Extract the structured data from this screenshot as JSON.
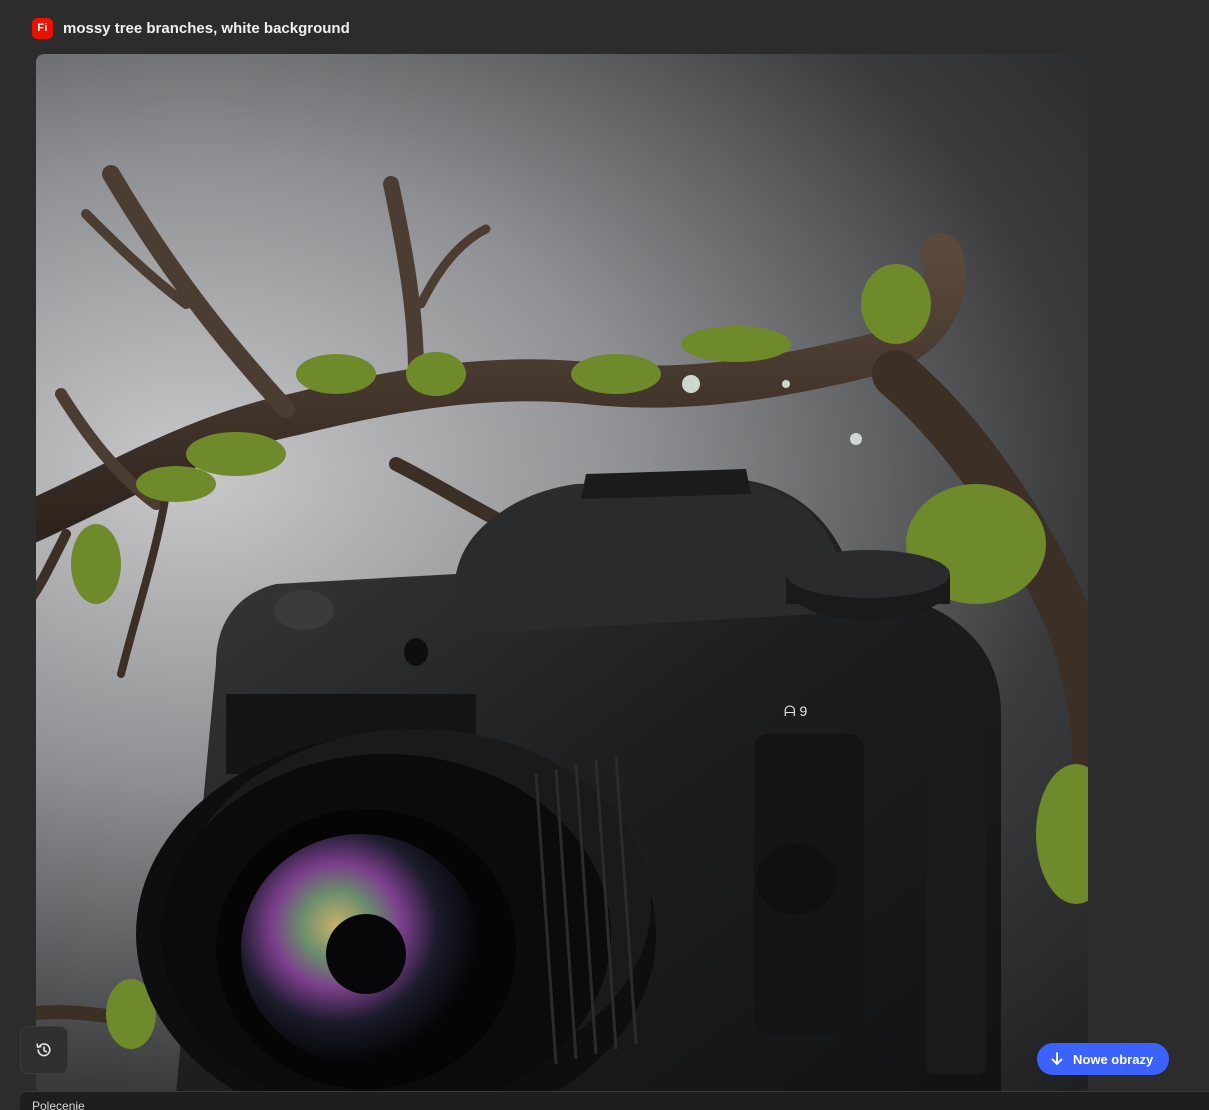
{
  "header": {
    "app_badge": "Fi",
    "prompt_title": "mossy tree branches, white background"
  },
  "image": {
    "description_icon": "generated-image"
  },
  "camera": {
    "mode_label": "ᗩ 9"
  },
  "actions": {
    "history_icon": "history-icon",
    "new_images_label": "Nowe obrazy",
    "new_images_icon": "arrow-down-icon"
  },
  "prompt_panel": {
    "label": "Polecenie"
  },
  "colors": {
    "background": "#2c2c2c",
    "accent_blue": "#3b63fb",
    "brand_red": "#eb1000"
  }
}
